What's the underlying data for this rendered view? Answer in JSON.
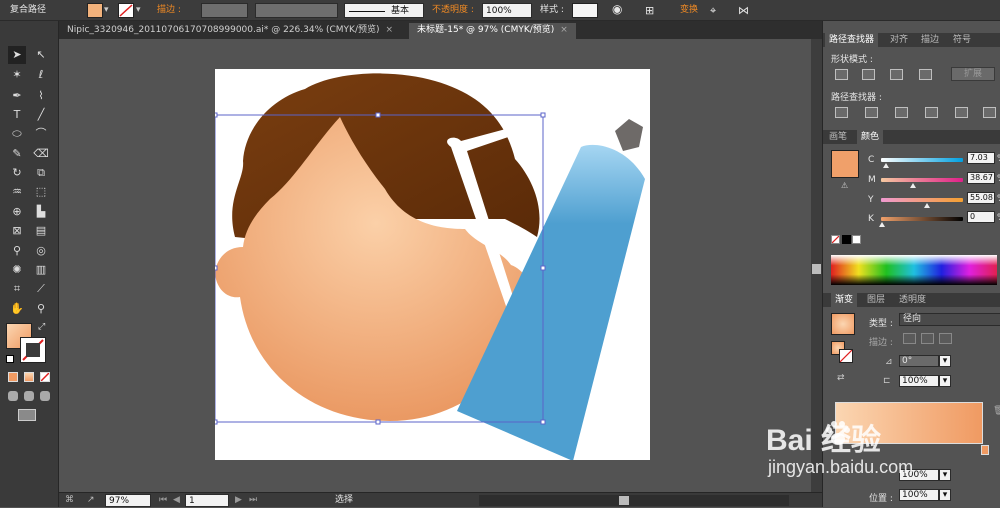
{
  "control_bar": {
    "object_type": "复合路径",
    "stroke_label": "描边 :",
    "stroke_profile": "基本",
    "opacity_label": "不透明度 :",
    "opacity_value": "100%",
    "style_label": "样式 :",
    "transform_label": "变换"
  },
  "document_tabs": [
    {
      "label": "Nipic_3320946_20110706170708999000.ai* @ 226.34% (CMYK/预览)",
      "active": false
    },
    {
      "label": "未标题-15* @ 97% (CMYK/预览)",
      "active": true
    }
  ],
  "pathfinder_panel": {
    "tabs": [
      "路径查找器",
      "对齐",
      "描边",
      "符号"
    ],
    "shape_modes_label": "形状模式 :",
    "expand_label": "扩展",
    "pathfinders_label": "路径查找器 :"
  },
  "color_panel": {
    "tabs": [
      "画笔",
      "颜色"
    ],
    "channels": [
      {
        "label": "C",
        "value": "7.03",
        "unit": "%"
      },
      {
        "label": "M",
        "value": "38.67",
        "unit": "%"
      },
      {
        "label": "Y",
        "value": "55.08",
        "unit": "%"
      },
      {
        "label": "K",
        "value": "0",
        "unit": "%"
      }
    ],
    "fill_color": "#f0a06a"
  },
  "gradient_panel": {
    "tabs": [
      "渐变",
      "图层",
      "透明度"
    ],
    "type_label": "类型 :",
    "type_value": "径向",
    "stroke_label": "描边 :",
    "angle_value": "0°",
    "aspect_value": "100%",
    "opacity_value": "100%",
    "location_label": "位置 :",
    "location_value": "100%"
  },
  "status_bar": {
    "zoom": "97%",
    "page": "1",
    "tool_status": "选择"
  },
  "watermark": {
    "brand": "Bai  经验",
    "url": "jingyan.baidu.com"
  },
  "colors": {
    "hair_dark": "#5a2a08",
    "hair": "#7a3e10",
    "skin_light": "#fbd0a8",
    "skin_dark": "#e9955e",
    "tube_blue": "#4e9fd0",
    "cap": "#6e6a68",
    "selection": "#5b63c8"
  }
}
